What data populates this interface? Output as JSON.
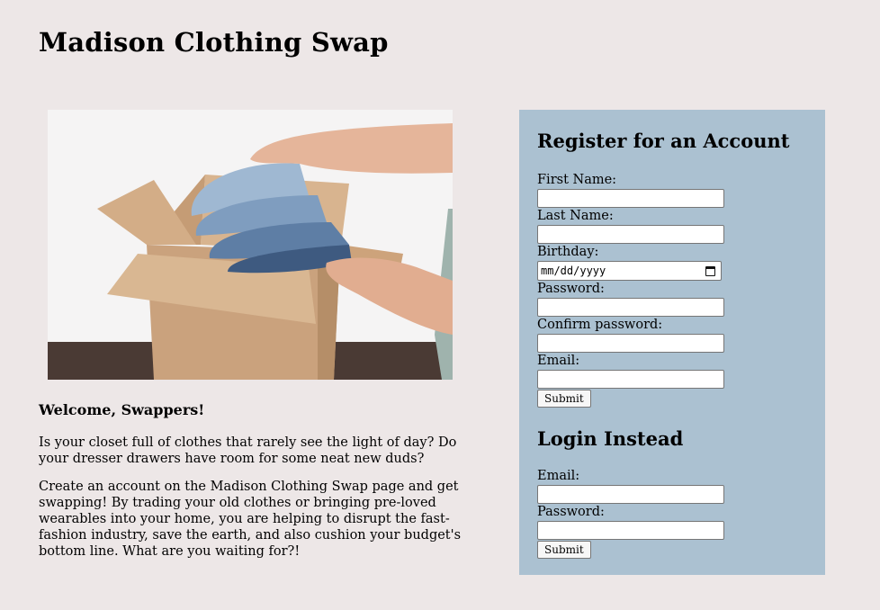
{
  "site": {
    "title": "Madison Clothing Swap"
  },
  "hero": {
    "image_label": "hands-packing-folded-jeans-into-cardboard-box"
  },
  "intro": {
    "heading": "Welcome, Swappers!",
    "paragraph1": "Is your closet full of clothes that rarely see the light of day? Do your dresser drawers have room for some neat new duds?",
    "paragraph2": "Create an account on the Madison Clothing Swap page and get swapping! By trading your old clothes or bringing pre-loved wearables into your home, you are helping to disrupt the fast-fashion industry, save the earth, and also cushion your budget's bottom line. What are you waiting for?!"
  },
  "register": {
    "heading": "Register for an Account",
    "first_name_label": "First Name:",
    "last_name_label": "Last Name:",
    "birthday_label": "Birthday:",
    "birthday_placeholder": "mm/dd/yyyy",
    "password_label": "Password:",
    "confirm_label": "Confirm password:",
    "email_label": "Email:",
    "submit_label": "Submit"
  },
  "login": {
    "heading": "Login Instead",
    "email_label": "Email:",
    "password_label": "Password:",
    "submit_label": "Submit"
  },
  "colors": {
    "page_background": "#ede7e7",
    "panel_background": "#abc1d1"
  }
}
